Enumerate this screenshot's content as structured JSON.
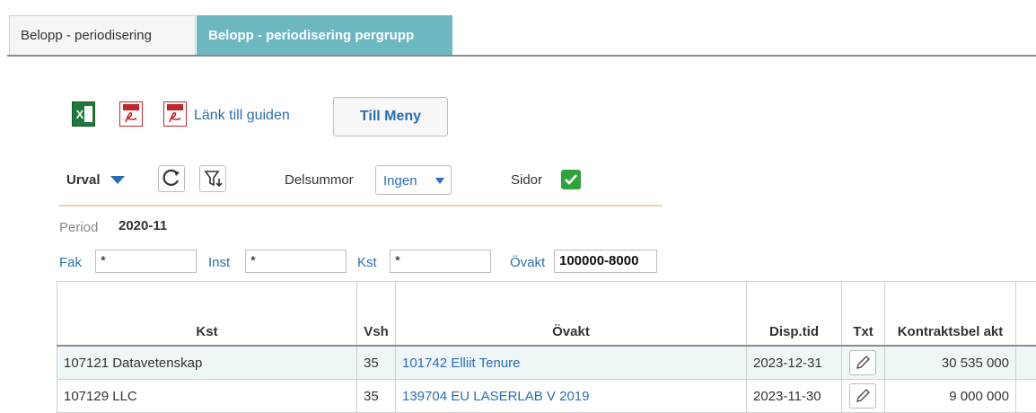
{
  "tabs": [
    {
      "label": "Belopp - periodisering",
      "active": false
    },
    {
      "label": "Belopp - periodisering pergrupp",
      "active": true
    }
  ],
  "toolbar": {
    "excel_icon": "excel-icon",
    "pdf_icon": "pdf-icon",
    "guide_link": "Länk till guiden",
    "menu_button": "Till Meny"
  },
  "filters": {
    "urval_label": "Urval",
    "delsummor_label": "Delsummor",
    "delsummor_value": "Ingen",
    "sidor_label": "Sidor",
    "sidor_checked": true
  },
  "period": {
    "label": "Period",
    "value": "2020-11"
  },
  "fields": {
    "fak": {
      "label": "Fak",
      "value": "*"
    },
    "inst": {
      "label": "Inst",
      "value": "*"
    },
    "kst": {
      "label": "Kst",
      "value": "*"
    },
    "ovakt": {
      "label": "Övakt",
      "value": "100000-8000"
    }
  },
  "table": {
    "headers": [
      "Kst",
      "Vsh",
      "Övakt",
      "Disp.tid",
      "Txt",
      "Kontraktsbel akt"
    ],
    "rows": [
      {
        "kst": "107121 Datavetenskap",
        "vsh": "35",
        "ovakt": "101742 Elliit Tenure",
        "disp": "2023-12-31",
        "belopp": "30 535 000"
      },
      {
        "kst": "107129 LLC",
        "vsh": "35",
        "ovakt": "139704 EU LASERLAB V 2019",
        "disp": "2023-11-30",
        "belopp": "9 000 000"
      }
    ]
  },
  "colors": {
    "accent": "#6db7c1",
    "link": "#2a6db5",
    "check": "#2ea43a"
  }
}
